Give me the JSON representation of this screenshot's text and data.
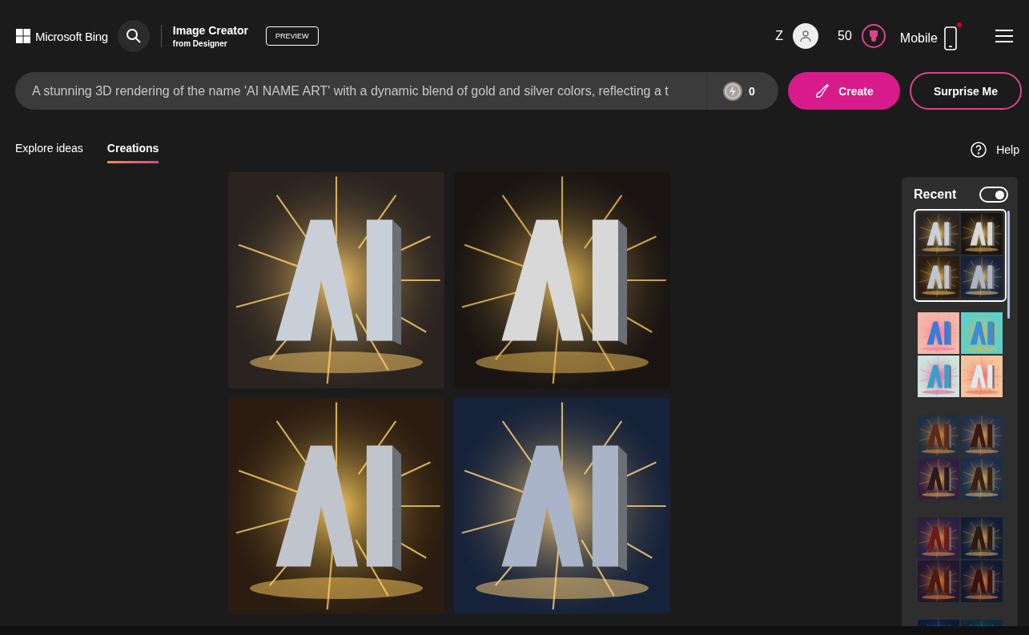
{
  "header": {
    "brand": "Microsoft Bing",
    "product": "Image Creator",
    "product_sub": "from Designer",
    "badge": "PREVIEW",
    "user_initial": "Z",
    "points": "50",
    "mobile": {
      "label": "Mobile",
      "notification": true
    }
  },
  "prompt": {
    "value": "A stunning 3D rendering of the name 'AI NAME ART' with a dynamic blend of gold and silver colors, reflecting a t",
    "boosts": "0"
  },
  "buttons": [
    {
      "label": "Create",
      "kind": "primary"
    },
    {
      "label": "Surprise Me",
      "kind": "outline"
    }
  ],
  "tabs": [
    {
      "label": "Explore ideas",
      "selected": false
    },
    {
      "label": "Creations",
      "selected": true
    }
  ],
  "help": "Help",
  "recent": {
    "title": "Recent",
    "on": true,
    "sets": [
      {
        "selected": true
      },
      {
        "selected": false
      },
      {
        "selected": false
      },
      {
        "selected": false
      },
      {
        "selected": false
      }
    ]
  }
}
